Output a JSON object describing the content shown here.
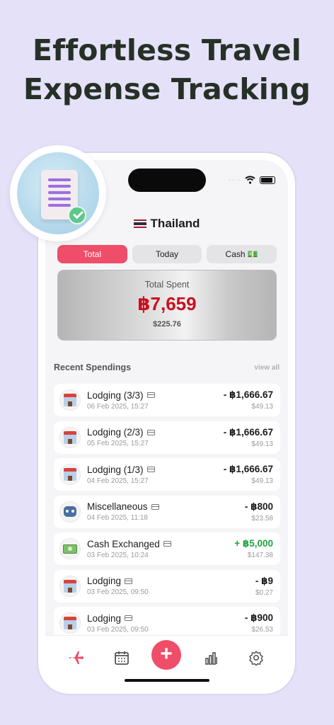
{
  "headline": [
    "Effortless Travel",
    "Expense Tracking"
  ],
  "country": {
    "name": "Thailand",
    "flag": "thailand-flag"
  },
  "segments": [
    {
      "label": "Total",
      "active": true
    },
    {
      "label": "Today",
      "active": false
    },
    {
      "label": "Cash 💵",
      "active": false
    }
  ],
  "total": {
    "label": "Total Spent",
    "amount": "฿7,659",
    "usd": "$225.76"
  },
  "recent": {
    "title": "Recent Spendings",
    "view_all": "view all",
    "items": [
      {
        "icon": "hotel-icon",
        "title": "Lodging (3/3)",
        "date": "06 Feb 2025, 15:27",
        "amount": "- ฿1,666.67",
        "usd": "$49.13",
        "positive": false
      },
      {
        "icon": "hotel-icon",
        "title": "Lodging (2/3)",
        "date": "05 Feb 2025, 15:27",
        "amount": "- ฿1,666.67",
        "usd": "$49.13",
        "positive": false
      },
      {
        "icon": "hotel-icon",
        "title": "Lodging (1/3)",
        "date": "04 Feb 2025, 15:27",
        "amount": "- ฿1,666.67",
        "usd": "$49.13",
        "positive": false
      },
      {
        "icon": "robot-icon",
        "title": "Miscellaneous",
        "date": "04 Feb 2025, 11:18",
        "amount": "- ฿800",
        "usd": "$23.58",
        "positive": false
      },
      {
        "icon": "cash-icon",
        "title": "Cash Exchanged",
        "date": "03 Feb 2025, 10:24",
        "amount": "+ ฿5,000",
        "usd": "$147.38",
        "positive": true
      },
      {
        "icon": "hotel-icon",
        "title": "Lodging",
        "date": "03 Feb 2025, 09:50",
        "amount": "- ฿9",
        "usd": "$0.27",
        "positive": false
      },
      {
        "icon": "hotel-icon",
        "title": "Lodging",
        "date": "03 Feb 2025, 09:50",
        "amount": "- ฿900",
        "usd": "$26.53",
        "positive": false
      }
    ]
  },
  "tabbar": [
    "airplane-icon",
    "calendar-icon",
    "add-icon",
    "chart-icon",
    "settings-icon"
  ],
  "colors": {
    "accent": "#ef4d69",
    "negative_total": "#cc0f1e",
    "positive": "#1fa342"
  }
}
